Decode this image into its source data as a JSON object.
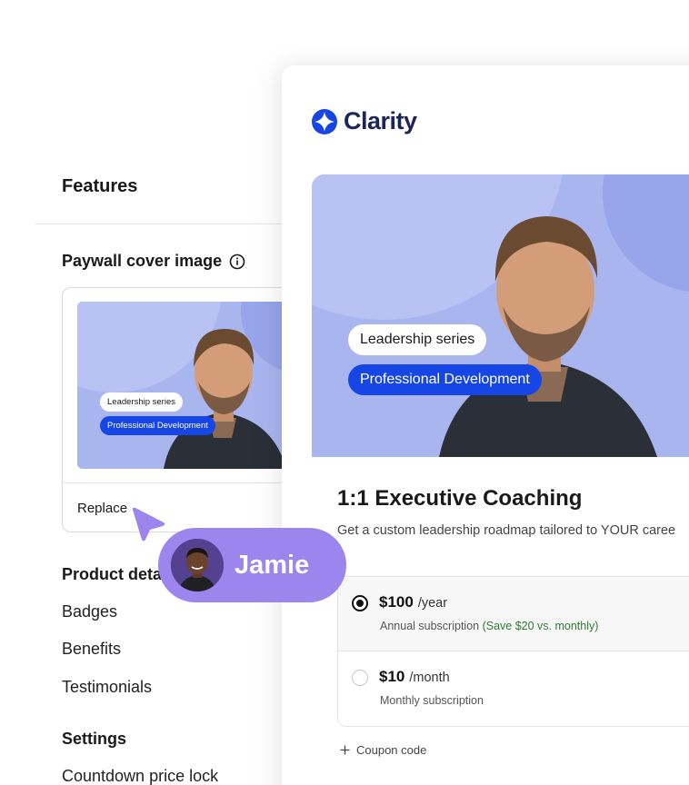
{
  "sidebar": {
    "features_title": "Features",
    "cover_image_title": "Paywall cover image",
    "replace_label": "Replace",
    "thumbnail_badges": {
      "series": "Leadership series",
      "category": "Professional Development"
    },
    "product_details_title": "Product deta",
    "product_items": [
      "Badges",
      "Benefits",
      "Testimonials"
    ],
    "settings_title": "Settings",
    "settings_items": [
      "Countdown price lock"
    ]
  },
  "preview": {
    "brand_name": "Clarity",
    "hero_badges": {
      "series": "Leadership series",
      "category": "Professional Development"
    },
    "course_title": "1:1 Executive Coaching",
    "course_subtitle": "Get a custom leadership roadmap tailored to YOUR caree",
    "plans": [
      {
        "price": "$100",
        "period": "/year",
        "description": "Annual subscription",
        "savings": "(Save $20 vs. monthly)",
        "selected": true
      },
      {
        "price": "$10",
        "period": "/month",
        "description": "Monthly subscription",
        "savings": "",
        "selected": false
      }
    ],
    "coupon_label": "Coupon code"
  },
  "collaborator": {
    "name": "Jamie"
  },
  "colors": {
    "brand_blue": "#1646e6",
    "hero_background": "#a9b5ef",
    "collaborator_purple": "#9d85ee",
    "savings_green": "#2e7d32"
  },
  "icons": {
    "info": "info-icon",
    "logo": "clarity-logo-icon",
    "plus": "plus-icon",
    "cursor": "cursor-arrow-icon"
  }
}
